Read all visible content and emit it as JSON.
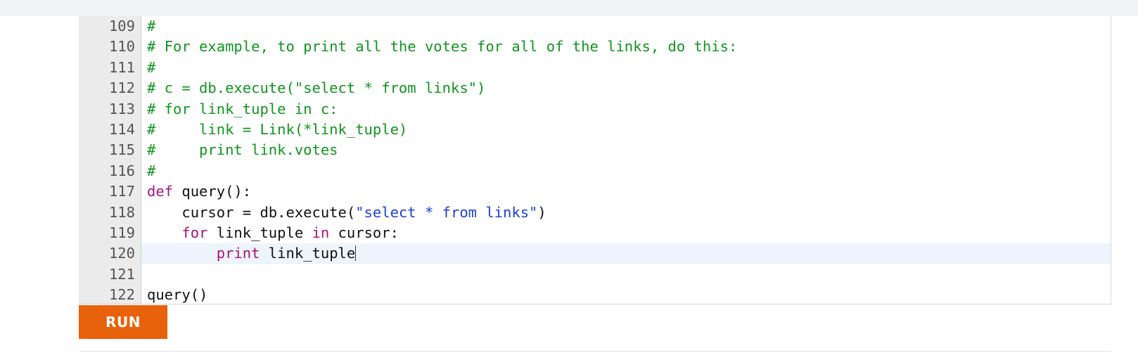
{
  "editor": {
    "active_line": "120",
    "lines": [
      {
        "number": "109",
        "tokens": [
          {
            "t": "#",
            "c": "comment"
          }
        ]
      },
      {
        "number": "110",
        "tokens": [
          {
            "t": "# For example, to print all the votes for all of the links, do this:",
            "c": "comment"
          }
        ]
      },
      {
        "number": "111",
        "tokens": [
          {
            "t": "#",
            "c": "comment"
          }
        ]
      },
      {
        "number": "112",
        "tokens": [
          {
            "t": "# c = db.execute(\"select * from links\")",
            "c": "comment"
          }
        ]
      },
      {
        "number": "113",
        "tokens": [
          {
            "t": "# for link_tuple in c:",
            "c": "comment"
          }
        ]
      },
      {
        "number": "114",
        "tokens": [
          {
            "t": "#     link = Link(*link_tuple)",
            "c": "comment"
          }
        ]
      },
      {
        "number": "115",
        "tokens": [
          {
            "t": "#     print link.votes",
            "c": "comment"
          }
        ]
      },
      {
        "number": "116",
        "tokens": [
          {
            "t": "#",
            "c": "comment"
          }
        ]
      },
      {
        "number": "117",
        "tokens": [
          {
            "t": "def",
            "c": "keyword"
          },
          {
            "t": " query():",
            "c": "plain"
          }
        ]
      },
      {
        "number": "118",
        "tokens": [
          {
            "t": "    cursor = db.execute(",
            "c": "plain"
          },
          {
            "t": "\"select * from links\"",
            "c": "string"
          },
          {
            "t": ")",
            "c": "plain"
          }
        ]
      },
      {
        "number": "119",
        "tokens": [
          {
            "t": "    ",
            "c": "plain"
          },
          {
            "t": "for",
            "c": "keyword"
          },
          {
            "t": " link_tuple ",
            "c": "plain"
          },
          {
            "t": "in",
            "c": "keyword"
          },
          {
            "t": " cursor:",
            "c": "plain"
          }
        ]
      },
      {
        "number": "120",
        "tokens": [
          {
            "t": "        ",
            "c": "plain"
          },
          {
            "t": "print",
            "c": "keyword"
          },
          {
            "t": " link_tuple",
            "c": "plain"
          }
        ]
      },
      {
        "number": "121",
        "tokens": []
      },
      {
        "number": "122",
        "tokens": [
          {
            "t": "query()",
            "c": "plain"
          }
        ]
      }
    ]
  },
  "toolbar": {
    "run_label": "RUN"
  },
  "colors": {
    "comment": "#10961e",
    "keyword": "#a4157b",
    "string": "#1d3fd8",
    "run_button": "#e8620c",
    "active_line_bg": "#eef4fb"
  }
}
